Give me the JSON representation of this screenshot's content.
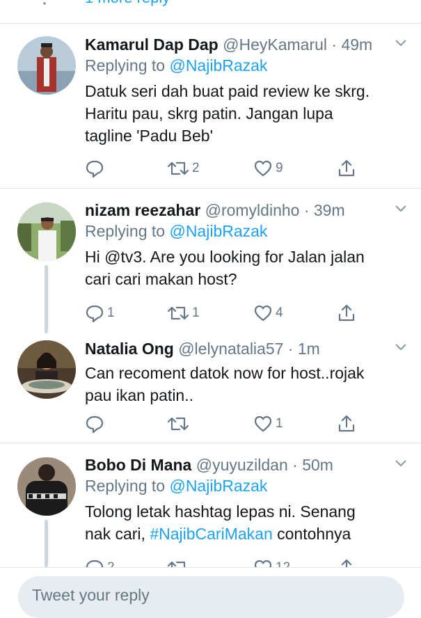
{
  "header": {
    "more_replies": "1 more reply"
  },
  "tweets": [
    {
      "name": "Kamarul Dap Dap",
      "handle": "@HeyKamarul",
      "time": "49m",
      "replying_prefix": "Replying to ",
      "replying_mention": "@NajibRazak",
      "lines": [
        "Datuk seri dah buat paid review ke skrg.",
        "Haritu pau, skrg patin. Jangan lupa",
        "tagline 'Padu Beb'"
      ],
      "reply_count": "",
      "retweet_count": "2",
      "like_count": "9"
    },
    {
      "name": "nizam reezahar",
      "handle": "@romyldinho",
      "time": "39m",
      "replying_prefix": "Replying to ",
      "replying_mention": "@NajibRazak",
      "lines": [
        "Hi @tv3. Are you looking for Jalan jalan",
        "cari cari makan host?"
      ],
      "reply_count": "1",
      "retweet_count": "1",
      "like_count": "4"
    },
    {
      "name": "Natalia Ong",
      "handle": "@lelynatalia57",
      "time": "1m",
      "lines": [
        "Can recoment datok now for host..rojak",
        "pau ikan patin.."
      ],
      "reply_count": "",
      "retweet_count": "",
      "like_count": "1"
    },
    {
      "name": "Bobo Di Mana",
      "handle": "@yuyuzildan",
      "time": "50m",
      "replying_prefix": "Replying to ",
      "replying_mention": "@NajibRazak",
      "line1": "Tolong letak hashtag lepas ni. Senang",
      "line2_before": "nak cari, ",
      "line2_hashtag": "#NajibCariMakan",
      "line2_after": " contohnya",
      "reply_count": "2",
      "like_count": "12"
    }
  ],
  "composer": {
    "placeholder": "Tweet your reply"
  },
  "colors": {
    "link": "#1da1f2",
    "secondary": "#657786",
    "divider": "#e1e8ed",
    "thread": "#ccd6dd"
  },
  "icons": [
    "reply-icon",
    "retweet-icon",
    "like-icon",
    "share-icon",
    "chevron-down-icon"
  ]
}
